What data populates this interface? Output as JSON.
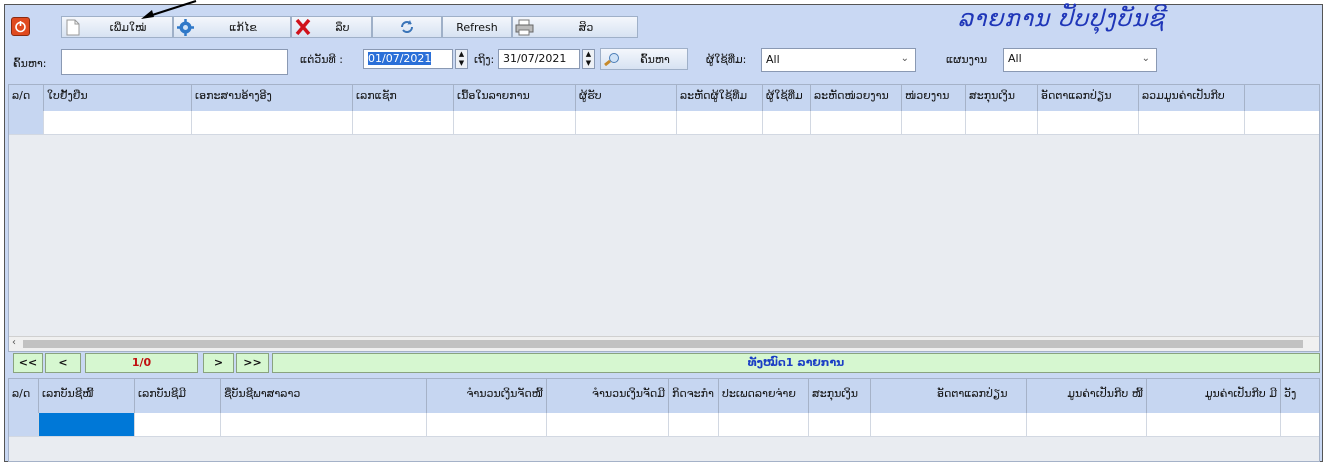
{
  "toolbar": {
    "new_label": "ເພີ່ມໃໝ່",
    "edit_label": "ແກ້ໄຂ",
    "delete_label": "ລຶບ",
    "refresh_label": "Refresh",
    "print_label": "ສິວ"
  },
  "title": "ລາຍການ ປັບປຸງບັນຊີ",
  "filters": {
    "search_label": "ຄົ້ນຫາ:",
    "search_value": "",
    "from_label": "ແຕ່ວັນທີ :",
    "from_date": "01/07/2021",
    "to_label": "ເຖິງ:",
    "to_date": "31/07/2021",
    "search_button": "ຄົ້ນຫາ",
    "user_label": "ຜູ້ໃຊ້ທີ່ມ:",
    "user_value": "All",
    "dept_label": "ແຜນງານ",
    "dept_value": "All"
  },
  "main_table": {
    "headers": [
      "ລ/ດ",
      "ໃບຢັ້ງຢືນ",
      "ເອກະສານອ້າງອີງ",
      "ເລກແຊັກ",
      "ເນື້ອໃນລາຍການ",
      "ຜູ້ຮັບ",
      "ລະຫັດຜູ້ໃຊ້ທີ່ມ",
      "ຜູ້ໃຊ້ທີ່ມ",
      "ລະຫັດໜ່ວຍງານ",
      "ໜ່ວຍງານ",
      "ສະກຸນເງິນ",
      "ອັດຕາແລກປ່ຽນ",
      "ລວມມູນຄ່າເປັນກີບ"
    ]
  },
  "pager": {
    "first": "<<",
    "prev": "<",
    "page": "1/0",
    "next": ">",
    "last": ">>",
    "summary": "ທັງໝົດ1 ລາຍການ"
  },
  "detail_table": {
    "headers": [
      "ລ/ດ",
      "ເລກບັນຊີໜີ້",
      "ເລກບັນຊີມີ",
      "ຊື່ບັນຊີພາສາລາວ",
      "ຈຳນວນເງິນຈັດໜີ້",
      "ຈຳນວນເງິນຈັດມີ",
      "ກິດຈະກຳ",
      "ປະເພດລາຍຈ່າຍ",
      "ສະກຸນເງິນ",
      "ອັດຕາແລກປ່ຽນ",
      "ມູນຄ່າເປັນກີບ ໜີ້",
      "ມູນຄ່າເປັນກີບ ມີ",
      "ວັງ"
    ]
  },
  "colors": {
    "background": "#c9d8f3",
    "title": "#1f36b8",
    "pager_green": "#d6f7d0",
    "selected_cell": "#0078d7"
  }
}
